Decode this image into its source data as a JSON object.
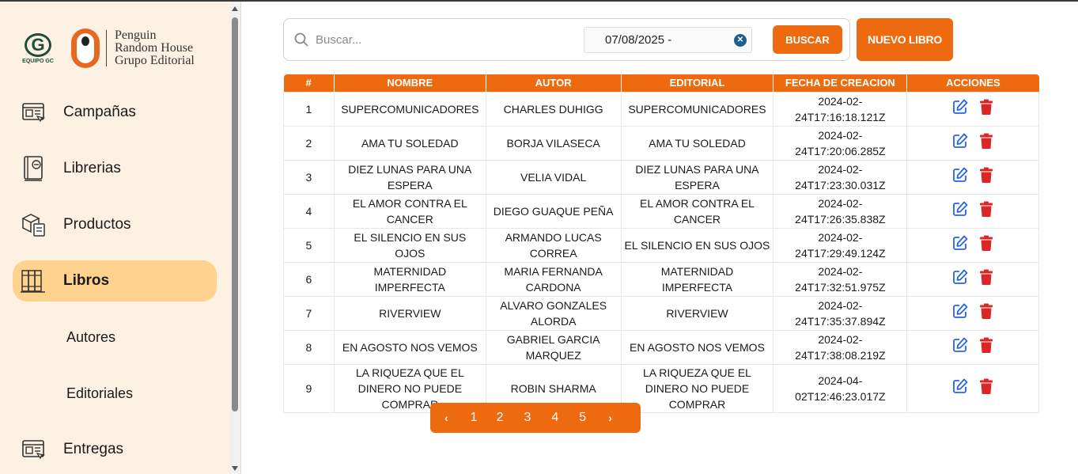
{
  "sidebar": {
    "logos": {
      "gc_letter": "G",
      "gc_text": "EQUIPO GC",
      "publisher_line1": "Penguin",
      "publisher_line2": "Random House",
      "publisher_line3": "Grupo Editorial"
    },
    "items": [
      {
        "label": "Campañas",
        "icon": "campaign-icon"
      },
      {
        "label": "Librerias",
        "icon": "bookstore-icon"
      },
      {
        "label": "Productos",
        "icon": "products-icon"
      },
      {
        "label": "Libros",
        "icon": "books-icon",
        "active": true
      },
      {
        "label": "Autores"
      },
      {
        "label": "Editoriales"
      },
      {
        "label": "Entregas",
        "icon": "deliveries-icon"
      }
    ]
  },
  "search": {
    "placeholder": "Buscar...",
    "date_value": "07/08/2025 -",
    "button": "BUSCAR"
  },
  "new_book_button": "NUEVO LIBRO",
  "table": {
    "headers": [
      "#",
      "NOMBRE",
      "AUTOR",
      "EDITORIAL",
      "FECHA DE CREACION",
      "ACCIONES"
    ],
    "rows": [
      [
        "1",
        "SUPERCOMUNICADORES",
        "CHARLES DUHIGG",
        "SUPERCOMUNICADORES",
        "2024-02-24T17:16:18.121Z"
      ],
      [
        "2",
        "AMA TU SOLEDAD",
        "BORJA VILASECA",
        "AMA TU SOLEDAD",
        "2024-02-24T17:20:06.285Z"
      ],
      [
        "3",
        "DIEZ LUNAS PARA UNA ESPERA",
        "VELIA VIDAL",
        "DIEZ LUNAS PARA UNA ESPERA",
        "2024-02-24T17:23:30.031Z"
      ],
      [
        "4",
        "EL AMOR CONTRA EL CANCER",
        "DIEGO GUAQUE PEÑA",
        "EL AMOR CONTRA EL CANCER",
        "2024-02-24T17:26:35.838Z"
      ],
      [
        "5",
        "EL SILENCIO EN SUS OJOS",
        "ARMANDO LUCAS CORREA",
        "EL SILENCIO EN SUS OJOS",
        "2024-02-24T17:29:49.124Z"
      ],
      [
        "6",
        "MATERNIDAD IMPERFECTA",
        "MARIA FERNANDA CARDONA",
        "MATERNIDAD IMPERFECTA",
        "2024-02-24T17:32:51.975Z"
      ],
      [
        "7",
        "RIVERVIEW",
        "ALVARO GONZALES ALORDA",
        "RIVERVIEW",
        "2024-02-24T17:35:37.894Z"
      ],
      [
        "8",
        "EN AGOSTO NOS VEMOS",
        "GABRIEL GARCIA MARQUEZ",
        "EN AGOSTO NOS VEMOS",
        "2024-02-24T17:38:08.219Z"
      ],
      [
        "9",
        "LA RIQUEZA QUE EL DINERO NO PUEDE COMPRAR",
        "ROBIN SHARMA",
        "LA RIQUEZA QUE EL DINERO NO PUEDE COMPRAR",
        "2024-04-02T12:46:23.017Z"
      ]
    ]
  },
  "pagination": {
    "prev": "‹",
    "pages": [
      "1",
      "2",
      "3",
      "4",
      "5"
    ],
    "next": "›"
  },
  "colors": {
    "accent": "#ee6a0f",
    "sidebar_bg": "#fdf1e4",
    "active_item": "#ffd28e",
    "edit_icon": "#2563eb",
    "delete_icon": "#dc2626"
  }
}
